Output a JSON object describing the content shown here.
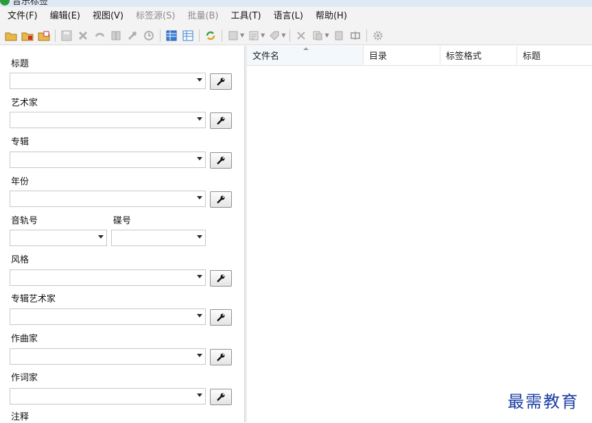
{
  "window": {
    "title": "音乐标签"
  },
  "menu": {
    "file": "文件(F)",
    "edit": "编辑(E)",
    "view": "视图(V)",
    "tag_source": "标签源(S)",
    "batch": "批量(B)",
    "tools": "工具(T)",
    "language": "语言(L)",
    "help": "帮助(H)"
  },
  "fields": {
    "title": {
      "label": "标题",
      "value": ""
    },
    "artist": {
      "label": "艺术家",
      "value": ""
    },
    "album": {
      "label": "专辑",
      "value": ""
    },
    "year": {
      "label": "年份",
      "value": ""
    },
    "track": {
      "label": "音轨号",
      "value": ""
    },
    "disc": {
      "label": "碟号",
      "value": ""
    },
    "genre": {
      "label": "风格",
      "value": ""
    },
    "album_artist": {
      "label": "专辑艺术家",
      "value": ""
    },
    "composer": {
      "label": "作曲家",
      "value": ""
    },
    "lyricist": {
      "label": "作词家",
      "value": ""
    },
    "comment": {
      "label": "注释"
    }
  },
  "file_list": {
    "columns": [
      "文件名",
      "目录",
      "标签格式",
      "标题"
    ]
  },
  "watermark": "最需教育"
}
